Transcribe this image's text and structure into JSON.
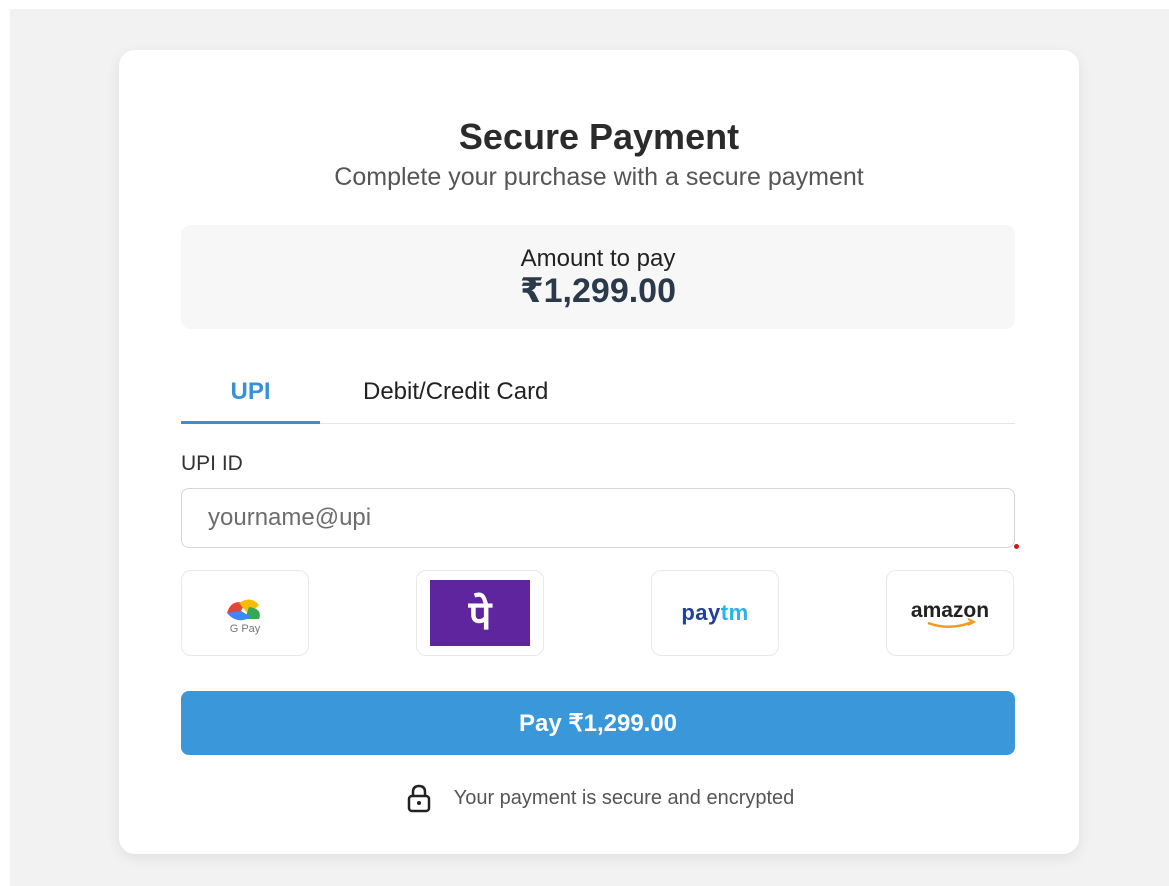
{
  "header": {
    "title": "Secure Payment",
    "subtitle": "Complete your purchase with a secure payment"
  },
  "amount": {
    "label": "Amount to pay",
    "value": "₹1,299.00"
  },
  "tabs": [
    {
      "label": "UPI",
      "active": true
    },
    {
      "label": "Debit/Credit Card",
      "active": false
    }
  ],
  "upi": {
    "field_label": "UPI ID",
    "placeholder": "yourname@upi",
    "value": ""
  },
  "apps": {
    "gpay": {
      "label": "G Pay",
      "icon": "google-pay-icon"
    },
    "phonepe": {
      "glyph": "पे",
      "icon": "phonepe-icon",
      "color": "#5f259f"
    },
    "paytm": {
      "prefix": "pay",
      "suffix": "tm",
      "icon": "paytm-icon"
    },
    "amazon": {
      "label": "amazon",
      "icon": "amazon-pay-icon"
    }
  },
  "pay_button": {
    "label": "Pay ₹1,299.00"
  },
  "footer": {
    "secure_text": "Your payment is secure and encrypted",
    "icon": "lock-icon"
  },
  "colors": {
    "accent": "#3a97d9",
    "tab_active": "#3a8fd6",
    "phonepe": "#5f259f",
    "paytm_dark": "#203f9e",
    "paytm_light": "#22b5f0"
  }
}
